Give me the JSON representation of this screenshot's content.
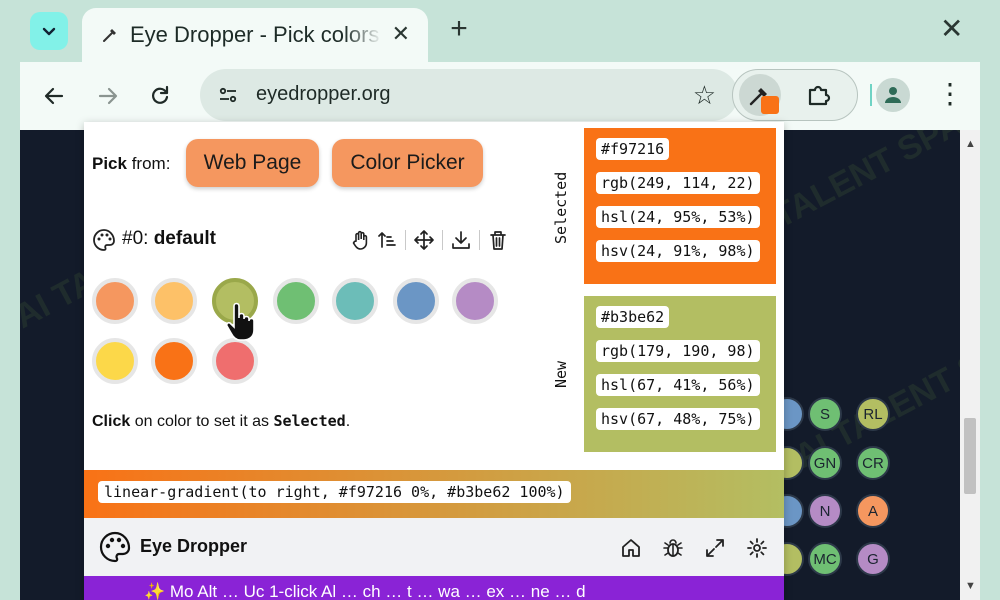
{
  "browser": {
    "tab": {
      "title": "Eye Dropper - Pick colors",
      "close": "✕"
    },
    "new_tab": "+",
    "window_close": "✕",
    "url": "eyedropper.org"
  },
  "page": {
    "watermark": "AI TALENT SPACE",
    "chips": [
      {
        "label": "",
        "color": "#6b96c5"
      },
      {
        "label": "S",
        "color": "#6fbf73"
      },
      {
        "label": "RL",
        "color": "#b3be62"
      },
      {
        "label": "",
        "color": "#b3be62"
      },
      {
        "label": "GN",
        "color": "#6fbf73"
      },
      {
        "label": "CR",
        "color": "#6fbf73"
      },
      {
        "label": "",
        "color": "#6b96c5"
      },
      {
        "label": "N",
        "color": "#b58bc5"
      },
      {
        "label": "A",
        "color": "#f5975f"
      },
      {
        "label": "",
        "color": "#b3be62"
      },
      {
        "label": "MC",
        "color": "#6fbf73"
      },
      {
        "label": "G",
        "color": "#b58bc5"
      }
    ]
  },
  "popup": {
    "pick_from": {
      "label": "Pick",
      "suffix": " from:"
    },
    "buttons": {
      "web_page": "Web Page",
      "color_picker": "Color Picker"
    },
    "palette": {
      "index": "#0:",
      "name": "default"
    },
    "swatches": [
      "#f5975f",
      "#fdc168",
      "#b3be62",
      "#6fbf73",
      "#6cbdb8",
      "#6b96c5",
      "#b58bc5",
      "#fcd849",
      "#f97216",
      "#ef6e6e"
    ],
    "hint": {
      "click": "Click",
      "middle": " on color to set it as ",
      "selected": "Selected",
      "end": "."
    },
    "selected": {
      "label": "Selected",
      "color": "#f97216",
      "hex": "#f97216",
      "rgb": "rgb(249, 114, 22)",
      "hsl": "hsl(24, 95%, 53%)",
      "hsv": "hsv(24, 91%, 98%)"
    },
    "new": {
      "label": "New",
      "color": "#b3be62",
      "hex": "#b3be62",
      "rgb": "rgb(179, 190, 98)",
      "hsl": "hsl(67, 41%, 56%)",
      "hsv": "hsv(67, 48%, 75%)"
    },
    "gradient": "linear-gradient(to right, #f97216 0%, #b3be62 100%)",
    "footer": {
      "name": "Eye Dropper"
    },
    "promo": "✨ Mo Alt … Uc 1-click Al … ch … t … wa … ex … ne … d"
  }
}
